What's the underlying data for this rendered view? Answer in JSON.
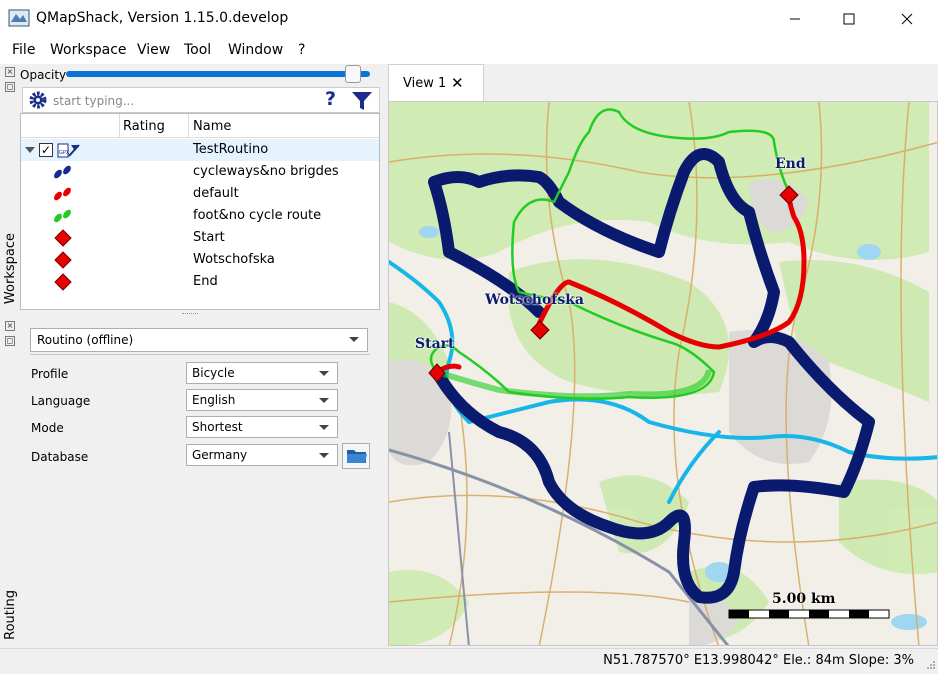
{
  "window": {
    "title": "QMapShack, Version 1.15.0.develop"
  },
  "menu": [
    "File",
    "Workspace",
    "View",
    "Tool",
    "Window",
    "?"
  ],
  "workspace": {
    "dock_title": "Workspace",
    "opacity_label": "Opacity",
    "opacity_value": 0.97,
    "search_placeholder": "start typing...",
    "columns": {
      "rating": "Rating",
      "name": "Name"
    },
    "project": {
      "name": "TestRoutino",
      "checked": true
    },
    "items": [
      {
        "name": "cycleways&no brigdes",
        "icon": "dark-blue-track-icon",
        "color": "#1a2a8c"
      },
      {
        "name": "default",
        "icon": "red-track-icon",
        "color": "#e60000"
      },
      {
        "name": "foot&no cycle route",
        "icon": "green-track-icon",
        "color": "#22cc22"
      },
      {
        "name": "Start",
        "icon": "red-diamond-waypoint-icon",
        "color": "#e60000"
      },
      {
        "name": "Wotschofska",
        "icon": "red-diamond-waypoint-icon",
        "color": "#e60000"
      },
      {
        "name": "End",
        "icon": "red-diamond-waypoint-icon",
        "color": "#e60000"
      }
    ]
  },
  "routing": {
    "dock_title": "Routing",
    "router": "Routino (offline)",
    "profile_label": "Profile",
    "profile": "Bicycle",
    "language_label": "Language",
    "language": "English",
    "mode_label": "Mode",
    "mode": "Shortest",
    "database_label": "Database",
    "database": "Germany"
  },
  "view": {
    "tab_label": "View 1",
    "labels": {
      "start": "Start",
      "wotschofska": "Wotschofska",
      "end": "End"
    },
    "scale": "5.00 km"
  },
  "status": "N51.787570° E13.998042° Ele.: 84m Slope: 3%",
  "colors": {
    "accent": "#0a74d6",
    "route_dark": "#0a1a6e",
    "route_red": "#e60000",
    "route_green": "#22cc22",
    "river": "#18b6e8"
  }
}
